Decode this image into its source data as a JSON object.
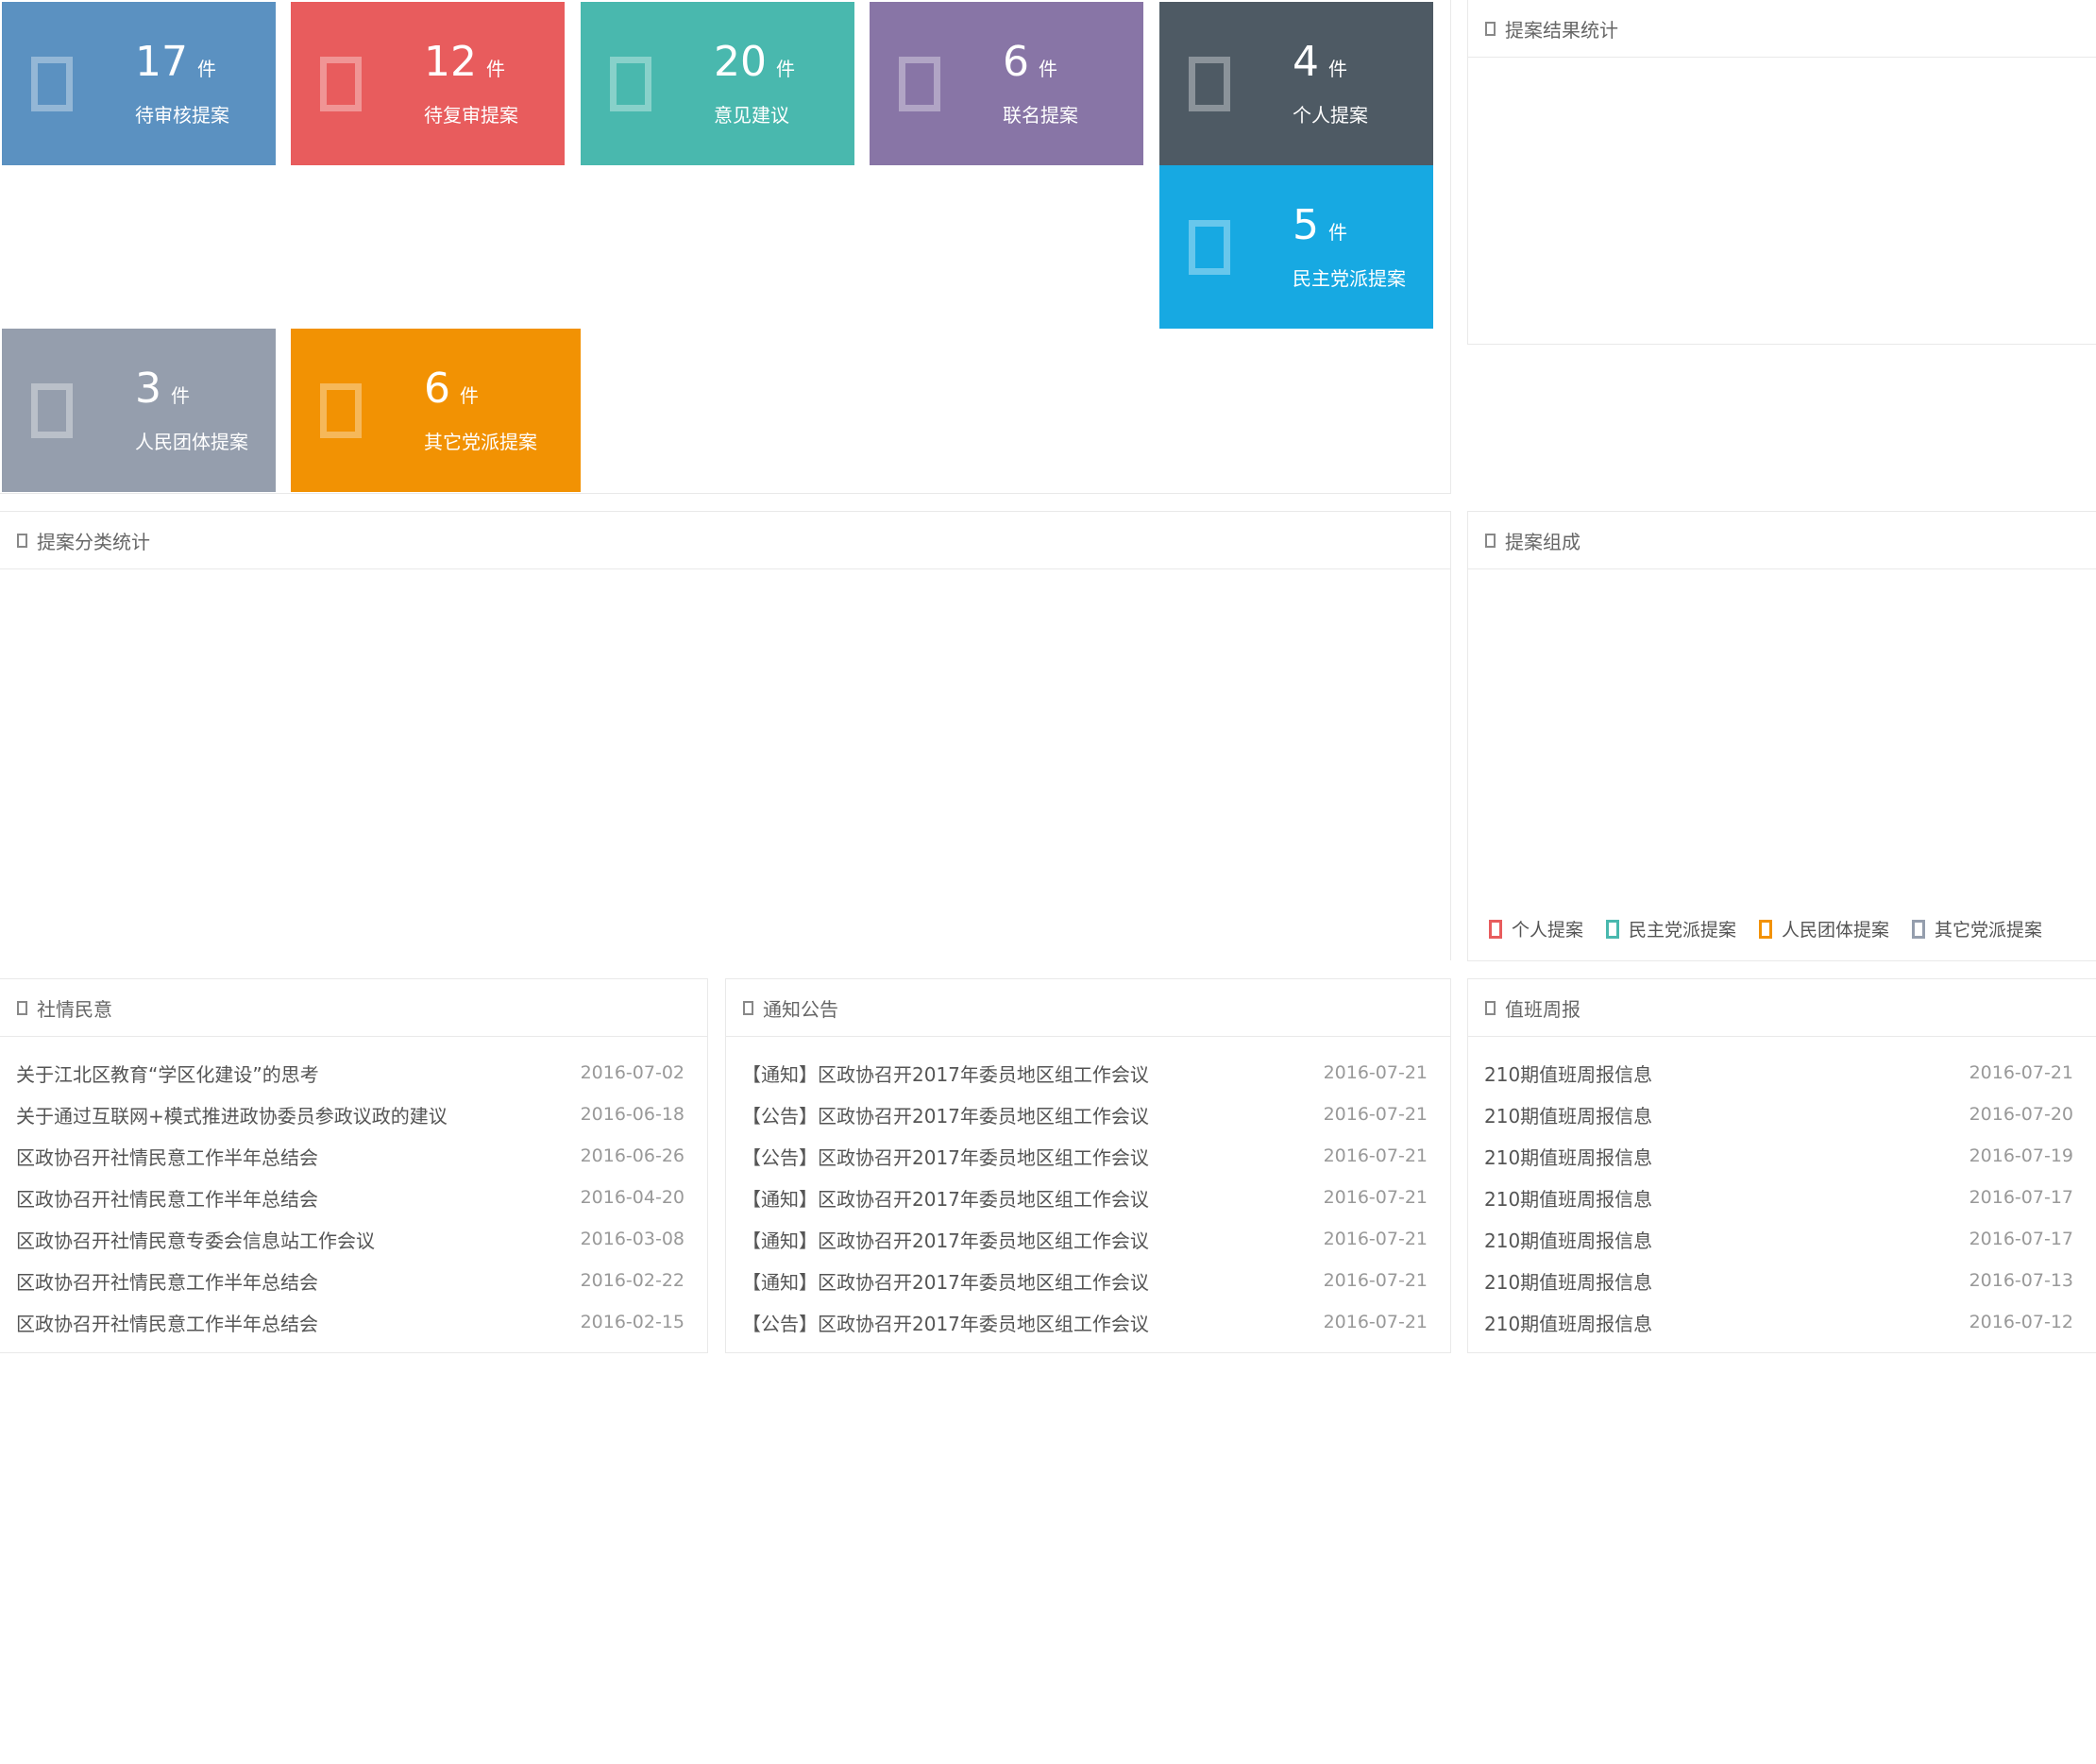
{
  "tiles": [
    {
      "count": "17",
      "unit": "件",
      "label": "待审核提案",
      "color": "#5b91c1"
    },
    {
      "count": "12",
      "unit": "件",
      "label": "待复审提案",
      "color": "#e85c5d"
    },
    {
      "count": "20",
      "unit": "件",
      "label": "意见建议",
      "color": "#49b8ae"
    },
    {
      "count": "6",
      "unit": "件",
      "label": "联名提案",
      "color": "#8875a6"
    },
    {
      "count": "4",
      "unit": "件",
      "label": "个人提案",
      "color": "#4e5a64"
    },
    {
      "count": "5",
      "unit": "件",
      "label": "民主党派提案",
      "color": "#17a9e2"
    },
    {
      "count": "3",
      "unit": "件",
      "label": "人民团体提案",
      "color": "#959ead"
    },
    {
      "count": "6",
      "unit": "件",
      "label": "其它党派提案",
      "color": "#f29203"
    }
  ],
  "panels": {
    "result_stats": {
      "title": "提案结果统计"
    },
    "category_stats": {
      "title": "提案分类统计"
    },
    "composition": {
      "title": "提案组成",
      "legend": [
        {
          "label": "个人提案",
          "color": "#e85c5d"
        },
        {
          "label": "民主党派提案",
          "color": "#49b8ae"
        },
        {
          "label": "人民团体提案",
          "color": "#f29203"
        },
        {
          "label": "其它党派提案",
          "color": "#959ead"
        }
      ]
    },
    "social": {
      "title": "社情民意",
      "items": [
        {
          "text": "关于江北区教育“学区化建设”的思考",
          "date": "2016-07-02"
        },
        {
          "text": "关于通过互联网+模式推进政协委员参政议政的建议",
          "date": "2016-06-18"
        },
        {
          "text": "区政协召开社情民意工作半年总结会",
          "date": "2016-06-26"
        },
        {
          "text": "区政协召开社情民意工作半年总结会",
          "date": "2016-04-20"
        },
        {
          "text": "区政协召开社情民意专委会信息站工作会议",
          "date": "2016-03-08"
        },
        {
          "text": "区政协召开社情民意工作半年总结会",
          "date": "2016-02-22"
        },
        {
          "text": "区政协召开社情民意工作半年总结会",
          "date": "2016-02-15"
        }
      ]
    },
    "notices": {
      "title": "通知公告",
      "items": [
        {
          "text": "【通知】区政协召开2017年委员地区组工作会议",
          "date": "2016-07-21"
        },
        {
          "text": "【公告】区政协召开2017年委员地区组工作会议",
          "date": "2016-07-21"
        },
        {
          "text": "【公告】区政协召开2017年委员地区组工作会议",
          "date": "2016-07-21"
        },
        {
          "text": "【通知】区政协召开2017年委员地区组工作会议",
          "date": "2016-07-21"
        },
        {
          "text": "【通知】区政协召开2017年委员地区组工作会议",
          "date": "2016-07-21"
        },
        {
          "text": "【通知】区政协召开2017年委员地区组工作会议",
          "date": "2016-07-21"
        },
        {
          "text": "【公告】区政协召开2017年委员地区组工作会议",
          "date": "2016-07-21"
        }
      ]
    },
    "duty": {
      "title": "值班周报",
      "items": [
        {
          "text": "210期值班周报信息",
          "date": "2016-07-21"
        },
        {
          "text": "210期值班周报信息",
          "date": "2016-07-20"
        },
        {
          "text": "210期值班周报信息",
          "date": "2016-07-19"
        },
        {
          "text": "210期值班周报信息",
          "date": "2016-07-17"
        },
        {
          "text": "210期值班周报信息",
          "date": "2016-07-17"
        },
        {
          "text": "210期值班周报信息",
          "date": "2016-07-13"
        },
        {
          "text": "210期值班周报信息",
          "date": "2016-07-12"
        }
      ]
    }
  }
}
